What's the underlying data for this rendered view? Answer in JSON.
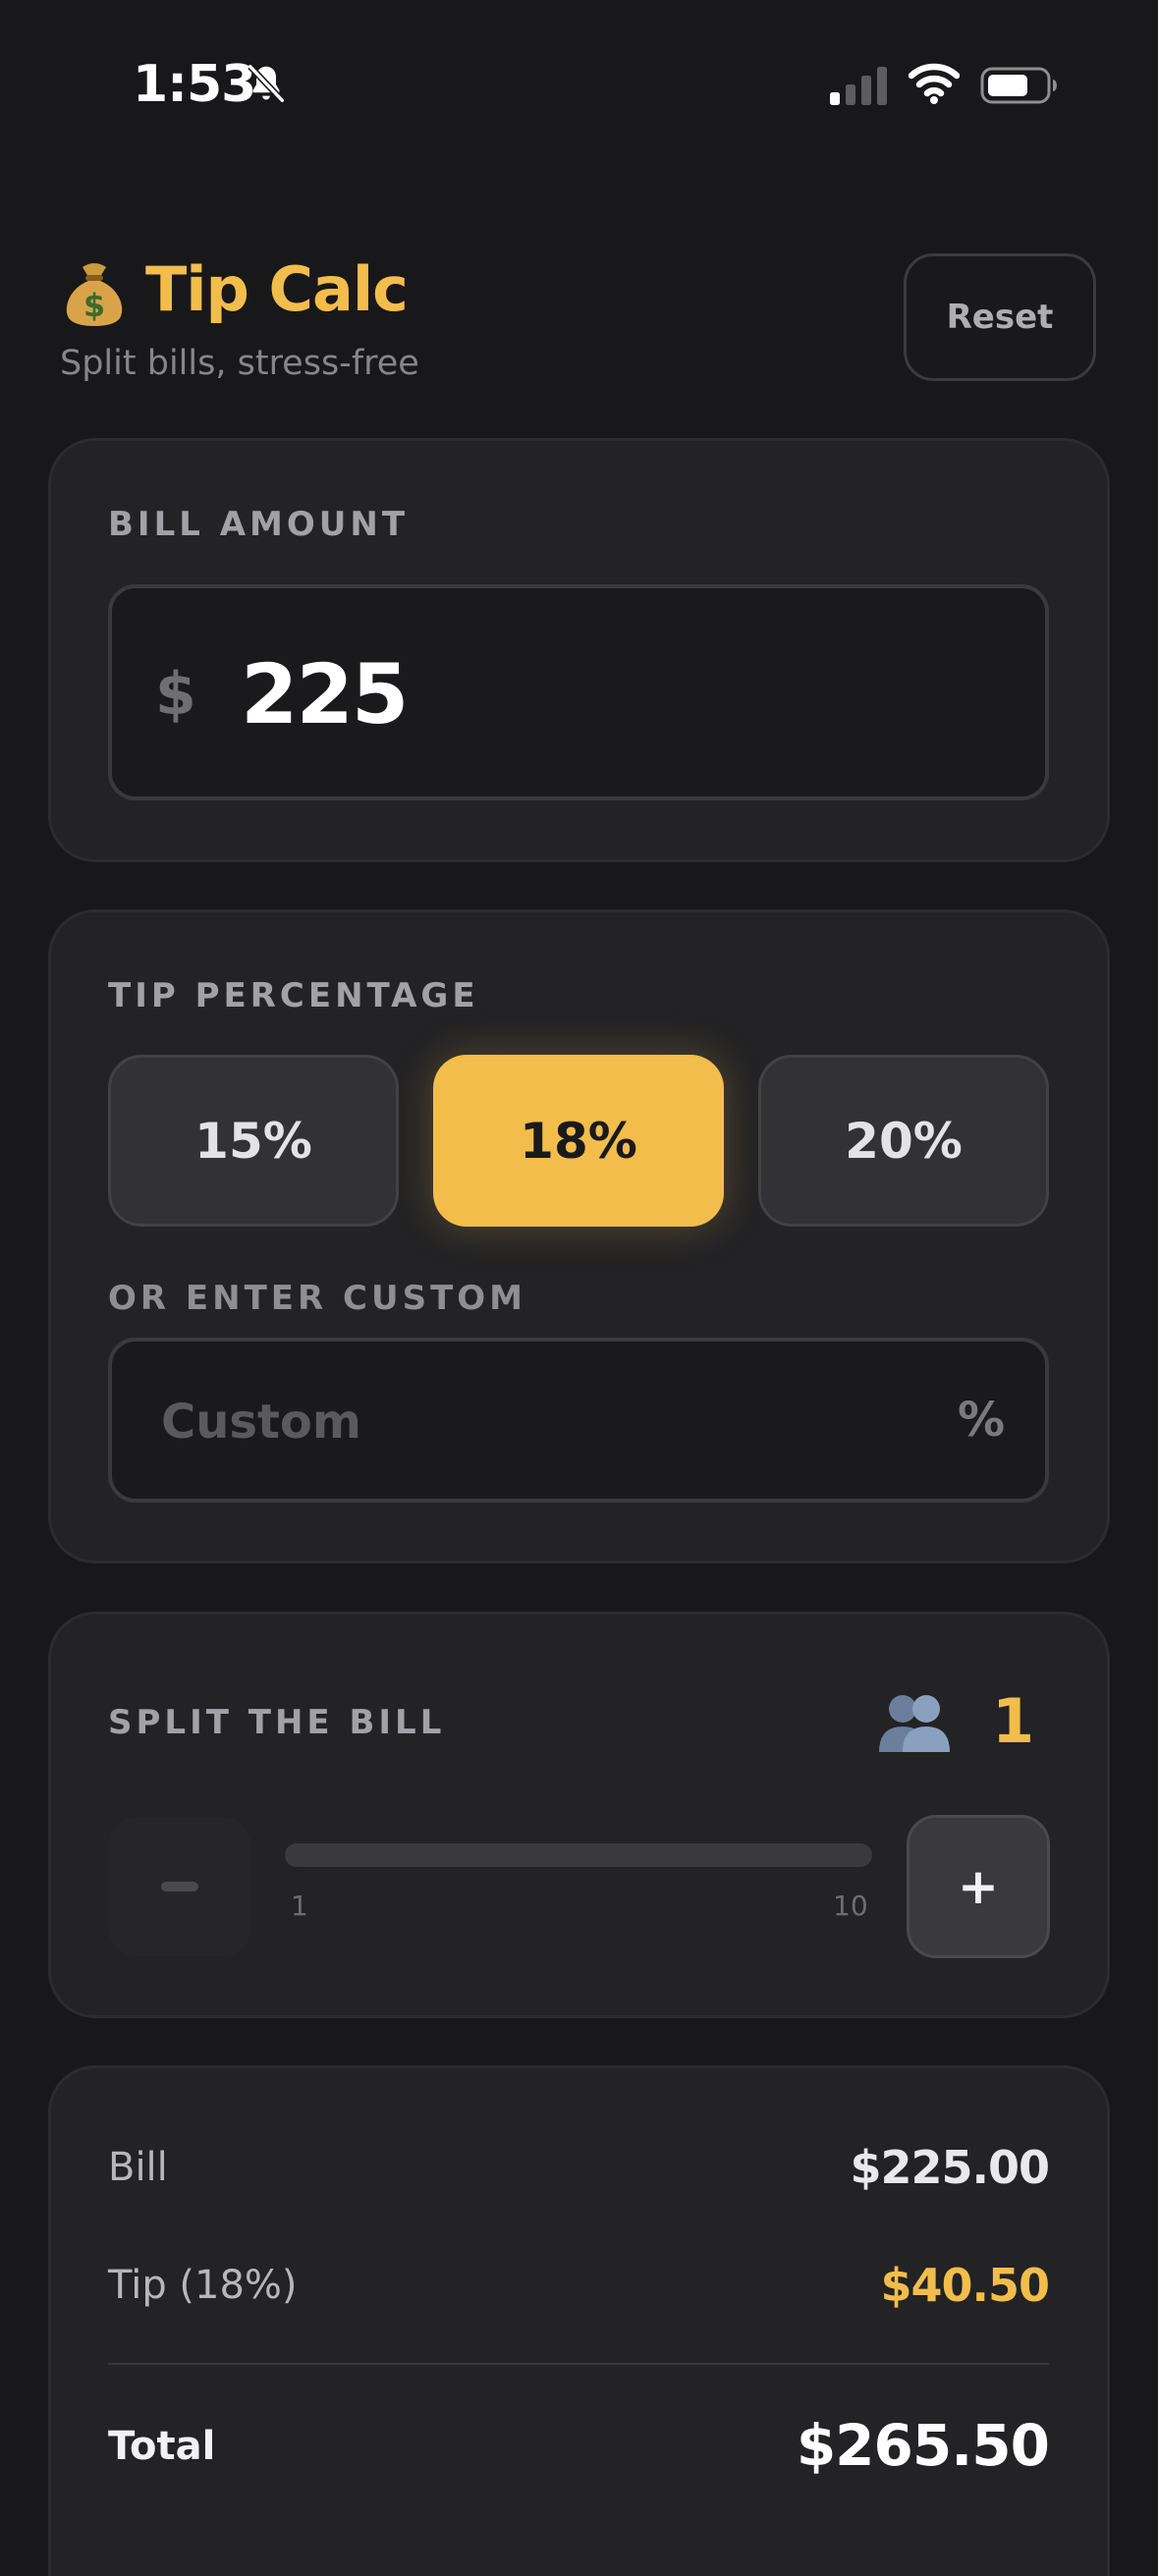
{
  "status_bar": {
    "time": "1:53"
  },
  "header": {
    "title": "Tip Calc",
    "subtitle": "Split bills, stress-free",
    "reset_label": "Reset"
  },
  "bill": {
    "label": "BILL AMOUNT",
    "currency_symbol": "$",
    "value": "225"
  },
  "tip": {
    "label": "TIP PERCENTAGE",
    "options": [
      {
        "label": "15%",
        "selected": false
      },
      {
        "label": "18%",
        "selected": true
      },
      {
        "label": "20%",
        "selected": false
      }
    ],
    "custom_label": "OR ENTER CUSTOM",
    "custom_placeholder": "Custom",
    "custom_suffix": "%"
  },
  "split": {
    "label": "SPLIT THE BILL",
    "people": "1",
    "minus_label": "−",
    "plus_label": "+",
    "slider_min": "1",
    "slider_max": "10",
    "slider_value": 1
  },
  "summary": {
    "bill_label": "Bill",
    "bill_value": "$225.00",
    "tip_label": "Tip (18%)",
    "tip_value": "$40.50",
    "total_label": "Total",
    "total_value": "$265.50"
  },
  "colors": {
    "accent": "#f2bd4b",
    "background": "#18181a",
    "card": "#232325"
  },
  "icons": {
    "logo": "money-bag-icon",
    "people": "people-icon",
    "silent": "bell-slash-icon"
  }
}
